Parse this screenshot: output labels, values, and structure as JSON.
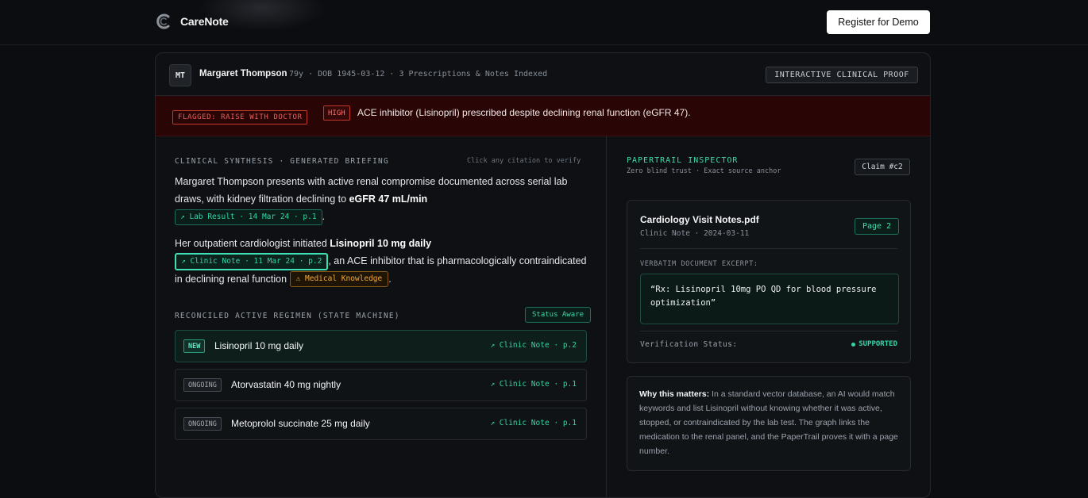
{
  "nav": {
    "brand": "CareNote",
    "cta_label": "Register for Demo"
  },
  "patient": {
    "initials": "MT",
    "name": "Margaret Thompson",
    "meta": "79y · DOB 1945-03-12 · 3 Prescriptions & Notes Indexed",
    "badge": "INTERACTIVE CLINICAL PROOF"
  },
  "alert": {
    "flag": "FLAGGED: RAISE WITH DOCTOR",
    "severity": "HIGH",
    "message": "ACE inhibitor (Lisinopril) prescribed despite declining renal function (eGFR 47)."
  },
  "synthesis": {
    "label": "CLINICAL SYNTHESIS · GENERATED BRIEFING",
    "hint": "Click any citation to verify",
    "p1_text": "Margaret Thompson presents with active renal compromise documented across serial lab draws, with kidney filtration declining to ",
    "p1_bold": "eGFR 47 mL/min",
    "p1_cite": "↗ Lab Result · 14 Mar 24 · p.1",
    "p1_end": ".",
    "p2_text": "Her outpatient cardiologist initiated ",
    "p2_bold": "Lisinopril 10 mg daily",
    "p2_cite": "↗ Clinic Note · 11 Mar 24 · p.2",
    "p2_mid": ", an ACE inhibitor that is pharmacologically contraindicated in declining renal function",
    "p2_warn": "⚠ Medical Knowledge",
    "p2_end": "."
  },
  "regimen": {
    "label": "RECONCILED ACTIVE REGIMEN (STATE MACHINE)",
    "status_badge": "Status Aware",
    "items": [
      {
        "tag": "NEW",
        "name": "Lisinopril 10 mg daily",
        "source": "↗ Clinic Note · p.2"
      },
      {
        "tag": "ONGOING",
        "name": "Atorvastatin 40 mg nightly",
        "source": "↗ Clinic Note · p.1"
      },
      {
        "tag": "ONGOING",
        "name": "Metoprolol succinate 25 mg daily",
        "source": "↗ Clinic Note · p.1"
      }
    ]
  },
  "inspector": {
    "title": "PAPERTRAIL INSPECTOR",
    "subtitle": "Zero blind trust · Exact source anchor",
    "claim": "Claim #c2",
    "doc": {
      "title": "Cardiology Visit Notes.pdf",
      "subtitle": "Clinic Note · 2024-03-11",
      "page": "Page 2",
      "excerpt_label": "VERBATIM DOCUMENT EXCERPT:",
      "excerpt": "“Rx: Lisinopril 10mg PO QD for blood pressure optimization”",
      "verification_label": "Verification Status:",
      "verification_value": "SUPPORTED"
    },
    "why": {
      "lead": "Why this matters:",
      "text": " In a standard vector database, an AI would match keywords and list Lisinopril without knowing whether it was active, stopped, or contraindicated by the lab test. The graph links the medication to the renal panel, and the PaperTrail proves it with a page number."
    }
  },
  "colors": {
    "accent": "#34d5a9",
    "alert_bg": "#2a0505",
    "alert_red": "#ef5b5b",
    "warning": "#f3a83b",
    "background": "#0c0d10"
  }
}
